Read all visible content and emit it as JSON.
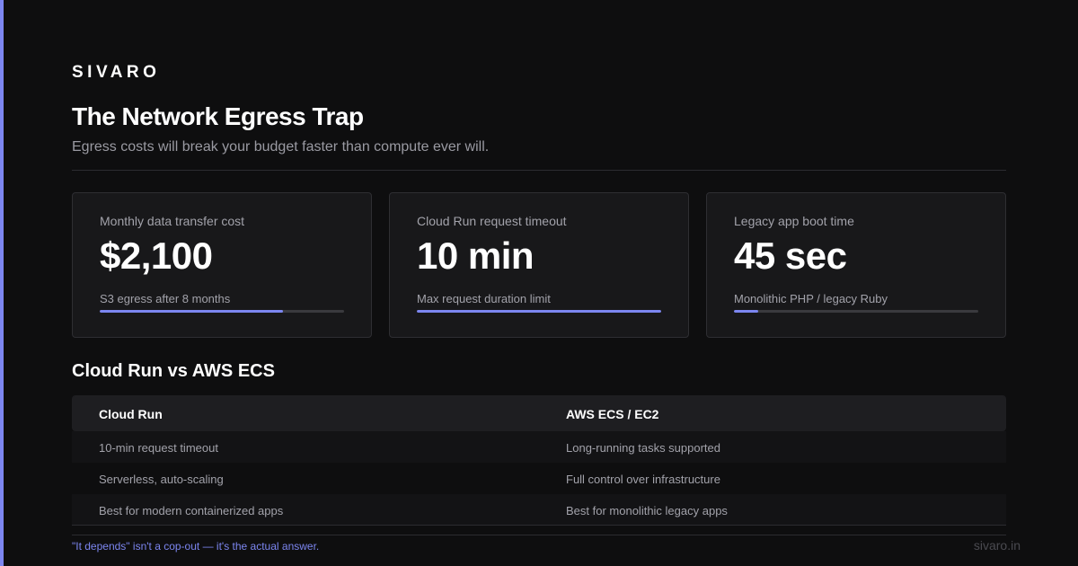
{
  "brand": "SIVARO",
  "title": "The Network Egress Trap",
  "subtitle": "Egress costs will break your budget faster than compute ever will.",
  "accent_color": "#7c86f0",
  "cards": [
    {
      "label": "Monthly data transfer cost",
      "value": "$2,100",
      "sub": "S3 egress after 8 months",
      "progress": 0.75
    },
    {
      "label": "Cloud Run request timeout",
      "value": "10 min",
      "sub": "Max request duration limit",
      "progress": 1.0
    },
    {
      "label": "Legacy app boot time",
      "value": "45 sec",
      "sub": "Monolithic PHP / legacy Ruby",
      "progress": 0.1
    }
  ],
  "comparison": {
    "title": "Cloud Run vs AWS ECS",
    "columns": [
      {
        "header": "Cloud Run",
        "rows": [
          "10-min request timeout",
          "Serverless, auto-scaling",
          "Best for modern containerized apps"
        ]
      },
      {
        "header": "AWS ECS / EC2",
        "rows": [
          "Long-running tasks supported",
          "Full control over infrastructure",
          "Best for monolithic legacy apps"
        ]
      }
    ]
  },
  "tagline": "\"It depends\" isn't a cop-out — it's the actual answer.",
  "footer_url": "sivaro.in"
}
